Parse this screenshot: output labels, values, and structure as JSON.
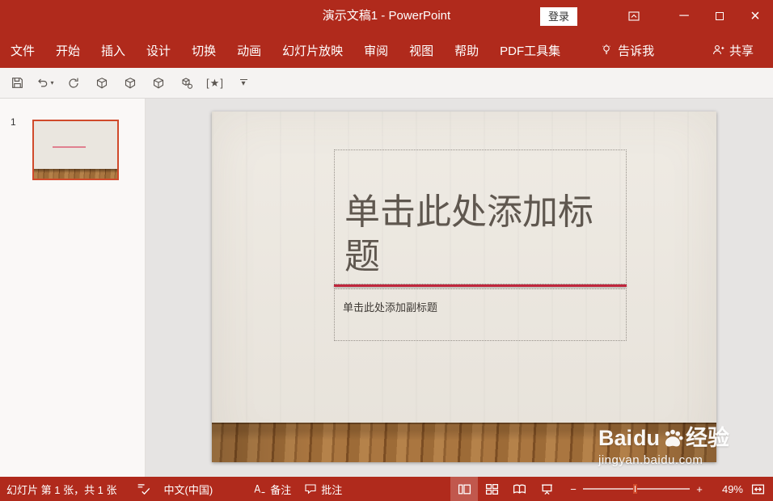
{
  "colors": {
    "chrome": "#B02A1C",
    "qat-bg": "#F5F3F2",
    "canvas-bg": "#E6E4E3",
    "panel-bg": "#FAF8F7",
    "slide-wall": "#EAE6DF",
    "accent": "#D04A2B",
    "divider": "#C0263C",
    "title-text": "#5F574F"
  },
  "titlebar": {
    "title": "演示文稿1 - PowerPoint",
    "login_label": "登录"
  },
  "ribbon": {
    "tabs": [
      "文件",
      "开始",
      "插入",
      "设计",
      "切换",
      "动画",
      "幻灯片放映",
      "审阅",
      "视图",
      "帮助",
      "PDF工具集"
    ],
    "tell_me": "告诉我",
    "share": "共享"
  },
  "qat": {
    "icons": [
      "save",
      "undo",
      "redo",
      "cube",
      "cube",
      "cube",
      "cube-settings",
      "star-brackets",
      "customize-toolbar"
    ]
  },
  "slide_panel": {
    "slide_number": "1"
  },
  "slide": {
    "title_placeholder": "单击此处添加标题",
    "subtitle_placeholder": "单击此处添加副标题"
  },
  "watermark": {
    "brand_prefix": "Bai",
    "brand_mid": "du",
    "brand_suffix": "经验",
    "url": "jingyan.baidu.com"
  },
  "statusbar": {
    "slide_info": "幻灯片 第 1 张，共 1 张",
    "language": "中文(中国)",
    "notes_label": "备注",
    "comments_label": "批注",
    "zoom_level": "49%",
    "view_icons": [
      "normal-view",
      "slide-sorter-view",
      "reading-view",
      "slideshow-view"
    ]
  }
}
